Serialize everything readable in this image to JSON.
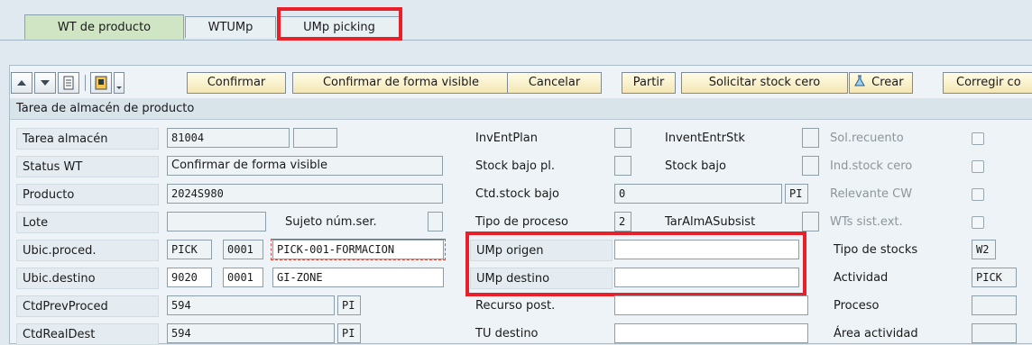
{
  "tabs": [
    "WT de producto",
    "WTUMp",
    "UMp picking"
  ],
  "toolbar": {
    "confirm": "Confirmar",
    "confirm_visible": "Confirmar de forma visible",
    "cancel": "Cancelar",
    "split": "Partir",
    "zero_stock": "Solicitar stock cero",
    "create": "Crear",
    "correct": "Corregir co"
  },
  "section_title": "Tarea de almacén de producto",
  "left": {
    "task_label": "Tarea almacén",
    "task_value": "81004",
    "status_label": "Status WT",
    "status_value": "Confirmar de forma visible",
    "product_label": "Producto",
    "product_value": "2024S980",
    "batch_label": "Lote",
    "serial_label": "Sujeto núm.ser.",
    "src_label": "Ubic.proced.",
    "src_type": "PICK",
    "src_sec": "0001",
    "src_bin": "PICK-001-FORMACION",
    "dst_label": "Ubic.destino",
    "dst_type": "9020",
    "dst_sec": "0001",
    "dst_bin": "GI-ZONE",
    "qty_plan_label": "CtdPrevProced",
    "qty_plan_value": "594",
    "qty_plan_unit": "PI",
    "qty_real_label": "CtdRealDest",
    "qty_real_value": "594",
    "qty_real_unit": "PI"
  },
  "middle": {
    "inv_plan": "InvEntPlan",
    "inv_stk": "InventEntrStk",
    "low_plan": "Stock bajo pl.",
    "low": "Stock bajo",
    "low_qty_label": "Ctd.stock bajo",
    "low_qty_value": "0",
    "low_qty_unit": "PI",
    "proc_type_label": "Tipo de proceso",
    "proc_type_value": "2",
    "subsys": "TarAlmASubsist",
    "hu_src": "UMp origen",
    "hu_dst": "UMp destino",
    "resource": "Recurso post.",
    "tu_dest": "TU destino"
  },
  "right": {
    "count_req": "Sol.recuento",
    "zero_ind": "Ind.stock cero",
    "cw": "Relevante CW",
    "ext": "WTs sist.ext.",
    "stock_type_label": "Tipo de stocks",
    "stock_type_value": "W2",
    "activity_label": "Actividad",
    "activity_value": "PICK",
    "process_label": "Proceso",
    "area_label": "Área actividad"
  },
  "colors": {
    "highlight": "#e8202a",
    "active_tab": "#cfe5c4",
    "button": "#f4e7b4"
  }
}
